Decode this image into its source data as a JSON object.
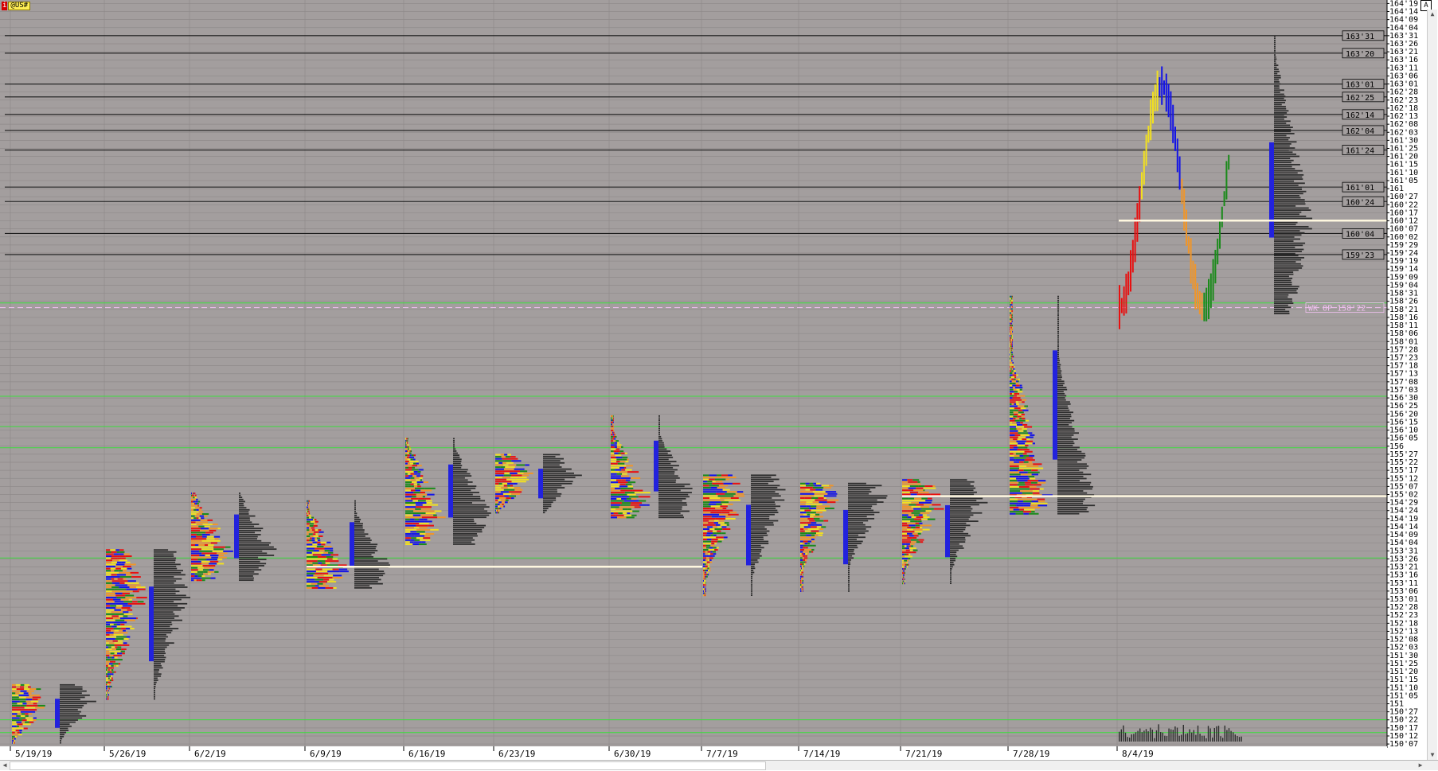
{
  "app": {
    "symbol_icon": "i",
    "symbol": "@US#",
    "corner_label": "A"
  },
  "chart_data": {
    "type": "market-profile",
    "price_axis_side": "right",
    "grid": true,
    "ylim": [
      150.22,
      164.6
    ],
    "price_labels": [
      "164'19",
      "164'14",
      "164'09",
      "164'04",
      "163'31",
      "163'26",
      "163'21",
      "163'16",
      "163'11",
      "163'06",
      "163'01",
      "162'28",
      "162'23",
      "162'18",
      "162'13",
      "162'08",
      "162'03",
      "161'30",
      "161'25",
      "161'20",
      "161'15",
      "161'10",
      "161'05",
      "161",
      "160'27",
      "160'22",
      "160'17",
      "160'12",
      "160'07",
      "160'02",
      "159'29",
      "159'24",
      "159'19",
      "159'14",
      "159'09",
      "159'04",
      "158'31",
      "158'26",
      "158'21",
      "158'16",
      "158'11",
      "158'06",
      "158'01",
      "157'28",
      "157'23",
      "157'18",
      "157'13",
      "157'08",
      "157'03",
      "156'30",
      "156'25",
      "156'20",
      "156'15",
      "156'10",
      "156'05",
      "156",
      "155'27",
      "155'22",
      "155'17",
      "155'12",
      "155'07",
      "155'02",
      "154'29",
      "154'24",
      "154'19",
      "154'14",
      "154'09",
      "154'04",
      "153'31",
      "153'26",
      "153'21",
      "153'16",
      "153'11",
      "153'06",
      "153'01",
      "152'28",
      "152'23",
      "152'18",
      "152'13",
      "152'08",
      "152'03",
      "151'30",
      "151'25",
      "151'20",
      "151'15",
      "151'10",
      "151'05",
      "151",
      "150'27",
      "150'22",
      "150'17",
      "150'12",
      "150'07"
    ],
    "highlight_range": {
      "from": 160.22,
      "to": 161.94,
      "color": "#ffcc00"
    },
    "level_lines": [
      {
        "label": "163'31",
        "price": 163.97
      },
      {
        "label": "163'20",
        "price": 163.63
      },
      {
        "label": "163'01",
        "price": 163.03
      },
      {
        "label": "162'25",
        "price": 162.78
      },
      {
        "label": "162'14",
        "price": 162.44
      },
      {
        "label": "162'04",
        "price": 162.13
      },
      {
        "label": "161'24",
        "price": 161.75
      },
      {
        "label": "161'01",
        "price": 161.03
      },
      {
        "label": "160'24",
        "price": 160.75
      },
      {
        "label": "160'04",
        "price": 160.13
      },
      {
        "label": "159'23",
        "price": 159.72
      }
    ],
    "weekly_open": {
      "label": "WK OP 158'22",
      "price": 158.69
    },
    "green_levels": [
      158.78,
      156.97,
      156.38,
      155.97,
      153.83,
      150.69,
      150.44
    ],
    "poc_lines": [
      {
        "price": 153.66,
        "from": "6/9/19",
        "to": "6/30/19"
      },
      {
        "price": 155.03,
        "from": "7/21/19",
        "to": "8/18/19"
      },
      {
        "price": 160.38,
        "from": "8/4/19",
        "to": "8/18/19"
      }
    ],
    "weeks": [
      {
        "date": "5/19/19",
        "low": 150.25,
        "high": 151.38,
        "poc": 151.03
      },
      {
        "date": "5/26/19",
        "low": 151.1,
        "high": 154.0,
        "poc": 153.13
      },
      {
        "date": "6/2/19",
        "low": 153.4,
        "high": 155.1,
        "poc": 154.0
      },
      {
        "date": "6/9/19",
        "low": 153.25,
        "high": 154.95,
        "poc": 153.66
      },
      {
        "date": "6/16/19",
        "low": 154.1,
        "high": 156.16,
        "poc": 154.72
      },
      {
        "date": "6/23/19",
        "low": 154.7,
        "high": 155.85,
        "poc": 155.45
      },
      {
        "date": "6/30/19",
        "low": 154.63,
        "high": 156.6,
        "poc": 155.0
      },
      {
        "date": "7/7/19",
        "low": 153.1,
        "high": 155.45,
        "poc": 154.99
      },
      {
        "date": "7/14/19",
        "low": 153.18,
        "high": 155.29,
        "poc": 155.03
      },
      {
        "date": "7/21/19",
        "low": 153.34,
        "high": 155.36,
        "poc": 154.9
      },
      {
        "date": "7/28/19",
        "low": 154.68,
        "high": 158.92,
        "poc": 155.03
      },
      {
        "date": "8/4/19",
        "low": 158.56,
        "high": 163.97,
        "poc": 160.38
      }
    ],
    "session_labels": [
      "5/19/19",
      "5/26/19",
      "6/2/19",
      "6/9/19",
      "6/16/19",
      "6/23/19",
      "6/30/19",
      "7/7/19",
      "7/14/19",
      "7/21/19",
      "7/28/19",
      "8/4/19"
    ]
  },
  "colors": {
    "plot_bg": "#a39e9e",
    "grid": "#8f8a8a",
    "level_line": "#1a1a1a",
    "level_label_bg": "#a39e9e",
    "green": "#3ddc3d",
    "poc": "#fff8e0",
    "wk_open": "#f0c0f0",
    "tpo_red": "#e81010",
    "tpo_orange": "#f0962a",
    "tpo_yellow": "#f2e020",
    "tpo_blue": "#1414e6",
    "tpo_green": "#1a8a1a",
    "profile_dark": "#2e2e2e",
    "va_bar": "#2222dd"
  }
}
